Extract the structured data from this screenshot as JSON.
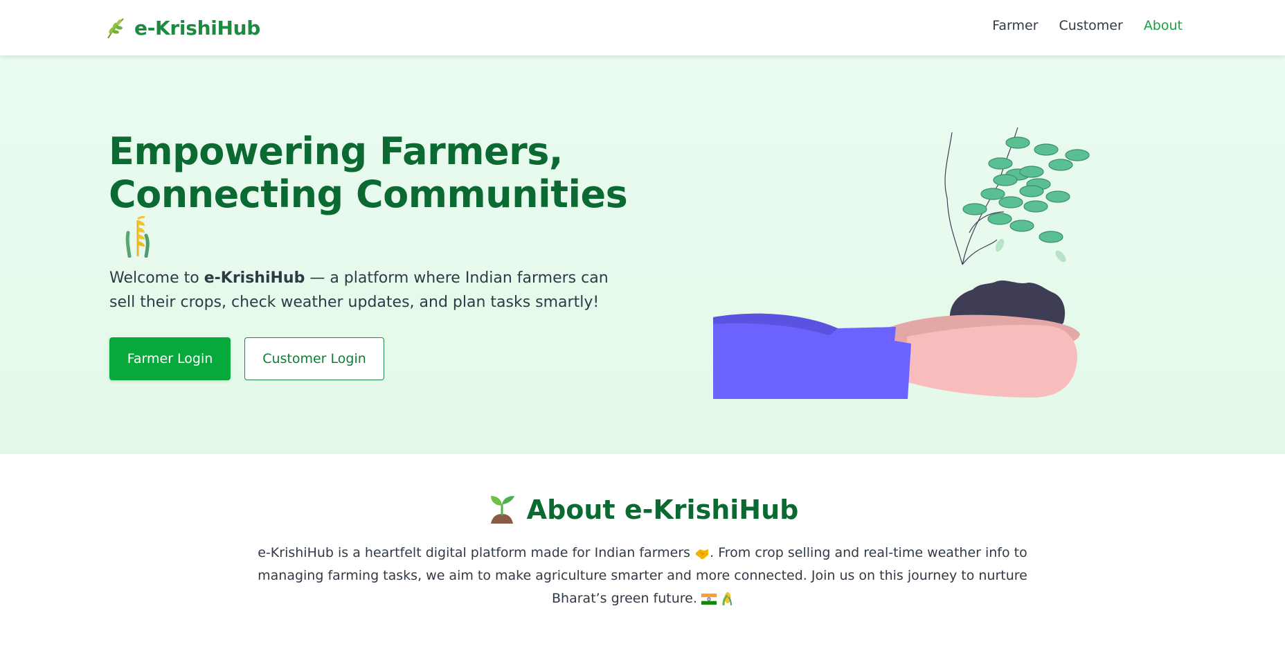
{
  "brand": {
    "name": "e-KrishiHub",
    "icon": "herb-leaf-icon"
  },
  "nav": {
    "items": [
      {
        "label": "Farmer",
        "active": false
      },
      {
        "label": "Customer",
        "active": false
      },
      {
        "label": "About",
        "active": true
      }
    ]
  },
  "hero": {
    "title_line1": "Empowering Farmers,",
    "title_line2": "Connecting Communities",
    "title_icon": "wheat-sheaf-icon",
    "desc_prefix": "Welcome to ",
    "desc_brand": "e-KrishiHub",
    "desc_suffix": " — a platform where Indian farmers can sell their crops, check weather updates, and plan tasks smartly!",
    "farmer_login": "Farmer Login",
    "customer_login": "Customer Login",
    "illustration": "hands-holding-plant-illustration"
  },
  "about": {
    "title": "About e-KrishiHub",
    "title_icon": "seedling-icon",
    "text_part1": "e-KrishiHub is a heartfelt digital platform made for Indian farmers",
    "text_part2": ". From crop selling and real-time weather info to managing farming tasks, we aim to make agriculture smarter and more connected. Join us on this journey to nurture Bharat’s green future.",
    "text_icons": [
      "handshake-icon",
      "india-flag-icon",
      "corn-icon"
    ]
  },
  "colors": {
    "primary": "#08a93c",
    "heading": "#0b6a31",
    "brand": "#198c3e",
    "hero_bg": "#e6faec",
    "text": "#2f3a46"
  }
}
